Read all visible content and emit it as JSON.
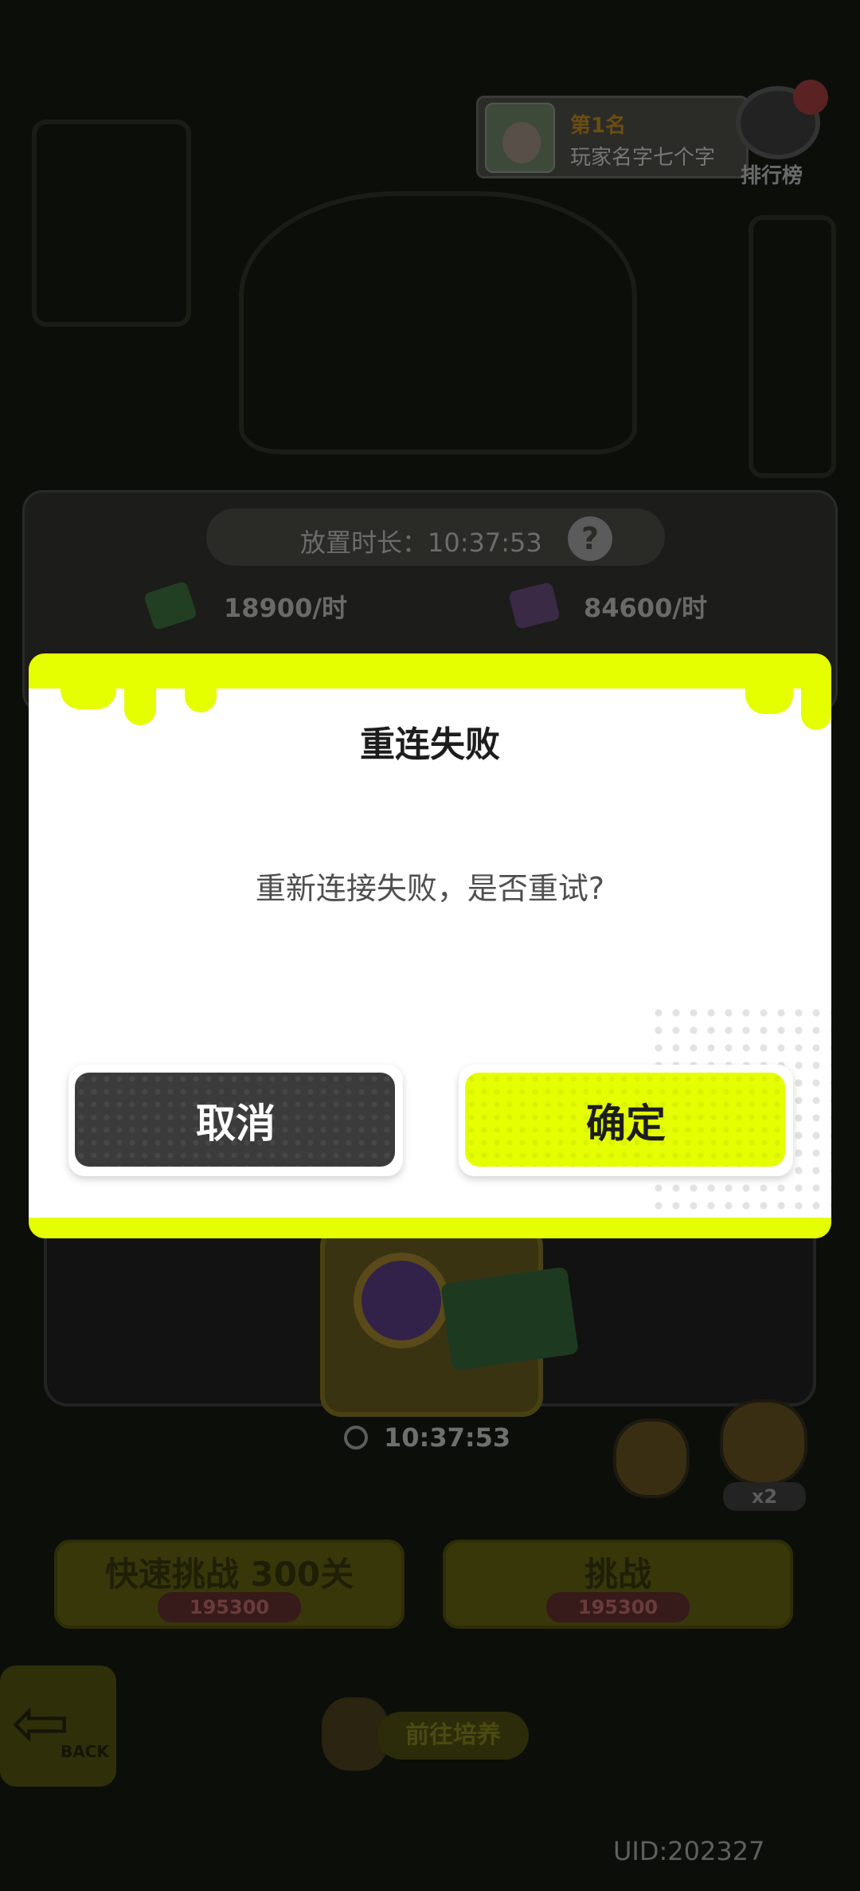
{
  "leaderboard": {
    "rank_title": "第1名",
    "player_name": "玩家名字七个字",
    "button_label": "排行榜"
  },
  "idle": {
    "duration_text": "放置时长：10:37:53",
    "help_symbol": "?",
    "cash_rate": "18900/时",
    "gem_rate": "84600/时"
  },
  "stage": {
    "timer": "10:37:53",
    "bear_badge": "x2"
  },
  "actions": {
    "quick_challenge_label": "快速挑战 300关",
    "quick_challenge_cost": "195300",
    "challenge_label": "挑战",
    "challenge_cost": "195300"
  },
  "nav": {
    "back_label": "BACK",
    "train_label": "前往培养"
  },
  "uid": "UID:202327",
  "dialog": {
    "title": "重连失败",
    "message": "重新连接失败，是否重试?",
    "cancel_label": "取消",
    "confirm_label": "确定"
  },
  "colors": {
    "accent": "#e5ff00",
    "dialog_bg": "#ffffff",
    "cancel_button": "#3b3b3b",
    "overlay_dim": "#000000"
  },
  "icons": {
    "cash": "cash-icon",
    "gem": "gem-icon",
    "clock": "clock-icon",
    "help": "help-icon",
    "trophy": "trophy-icon",
    "gift": "gift-icon",
    "back": "back-arrow-icon"
  }
}
